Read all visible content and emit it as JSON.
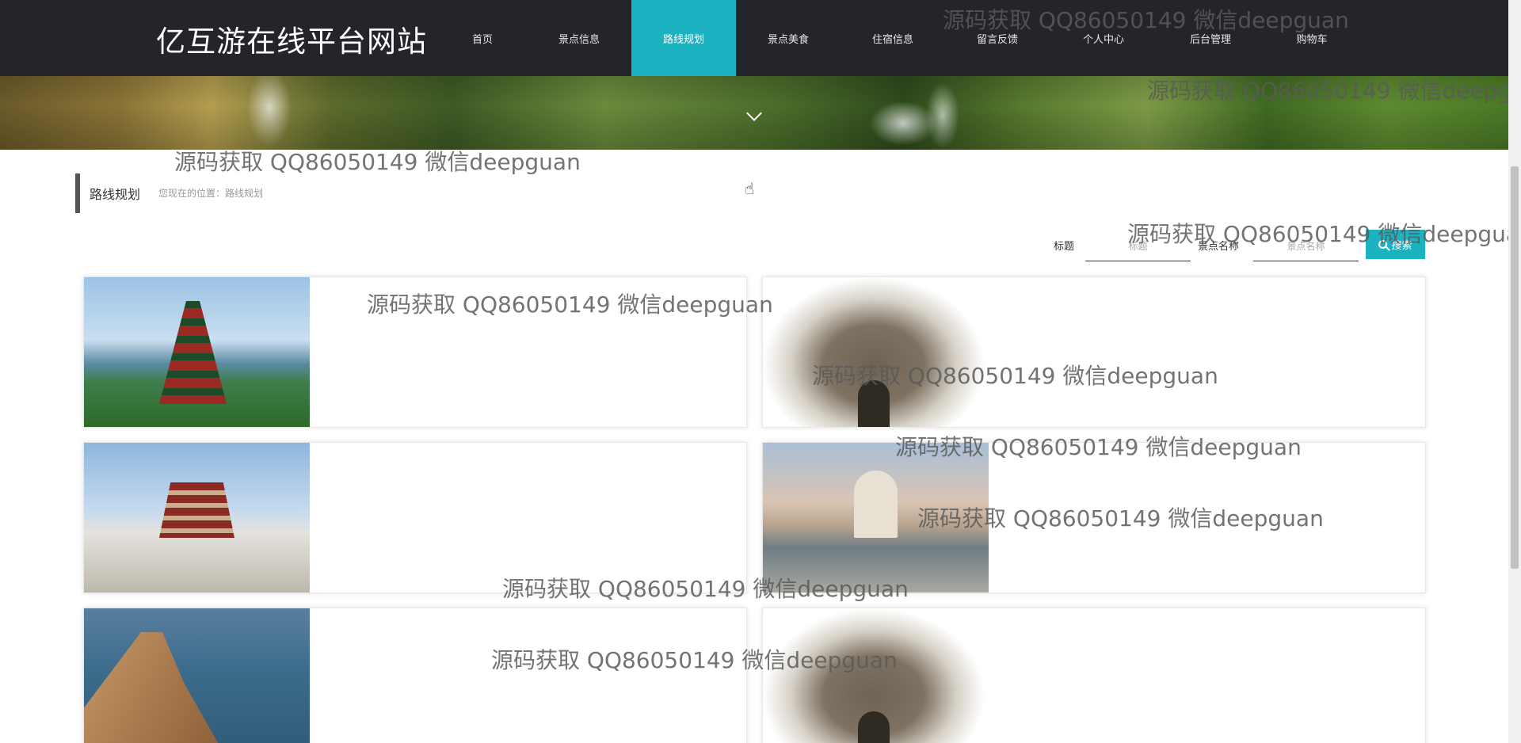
{
  "header": {
    "site_title": "亿互游在线平台网站",
    "nav": [
      {
        "label": "首页",
        "active": false
      },
      {
        "label": "景点信息",
        "active": false
      },
      {
        "label": "路线规划",
        "active": true
      },
      {
        "label": "景点美食",
        "active": false
      },
      {
        "label": "住宿信息",
        "active": false
      },
      {
        "label": "留言反馈",
        "active": false
      },
      {
        "label": "个人中心",
        "active": false
      },
      {
        "label": "后台管理",
        "active": false
      },
      {
        "label": "购物车",
        "active": false
      }
    ]
  },
  "breadcrumb": {
    "title": "路线规划",
    "path": "您现在的位置：路线规划"
  },
  "search": {
    "title_label": "标题",
    "title_placeholder": "标题",
    "spot_label": "景点名称",
    "spot_placeholder": "景点名称",
    "button_label": "搜索"
  },
  "cards": [
    {
      "image": "pagoda-tower-photo"
    },
    {
      "image": "stone-gate-photo"
    },
    {
      "image": "palace-complex-photo"
    },
    {
      "image": "mosque-reflection-photo"
    },
    {
      "image": "sea-cliff-photo"
    },
    {
      "image": "stone-gate-photo"
    }
  ],
  "watermark": "源码获取 QQ86050149 微信deepguan",
  "colors": {
    "header_bg": "#23252b",
    "accent": "#1bb3c2"
  }
}
